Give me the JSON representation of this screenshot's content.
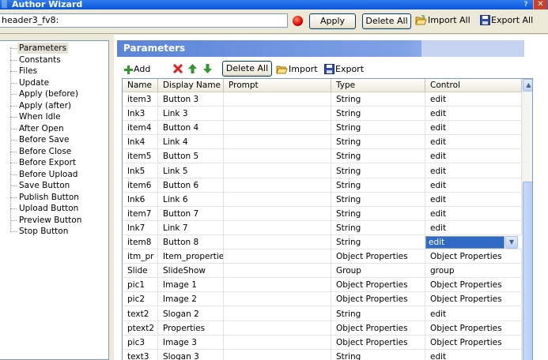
{
  "window": {
    "title": "Author Wizard",
    "help_glyph": "?",
    "close_glyph": "✕"
  },
  "toolbar": {
    "header_value": "header3_fv8:",
    "apply_label": "Apply",
    "delete_all_label": "Delete All",
    "import_all_label": "Import All",
    "export_all_label": "Export All"
  },
  "tree": {
    "items": [
      {
        "label": "Parameters",
        "selected": true
      },
      {
        "label": "Constants"
      },
      {
        "label": "Files"
      },
      {
        "label": "Update"
      },
      {
        "label": "Apply (before)"
      },
      {
        "label": "Apply (after)"
      },
      {
        "label": "When Idle"
      },
      {
        "label": "After Open"
      },
      {
        "label": "Before Save"
      },
      {
        "label": "Before Close"
      },
      {
        "label": "Before Export"
      },
      {
        "label": "Before Upload"
      },
      {
        "label": "Save Button"
      },
      {
        "label": "Publish Button"
      },
      {
        "label": "Upload Button"
      },
      {
        "label": "Preview Button"
      },
      {
        "label": "Stop Button"
      }
    ]
  },
  "panel": {
    "title": "Parameters",
    "add_label": "Add",
    "delete_all_label": "Delete All",
    "import_label": "Import",
    "export_label": "Export"
  },
  "grid": {
    "columns": [
      "Name",
      "Display Name",
      "Prompt",
      "Type",
      "Control"
    ],
    "rows": [
      [
        "item3",
        "Button 3",
        "",
        "String",
        "edit"
      ],
      [
        "lnk3",
        "Link 3",
        "",
        "String",
        "edit"
      ],
      [
        "item4",
        "Button 4",
        "",
        "String",
        "edit"
      ],
      [
        "lnk4",
        "Link 4",
        "",
        "String",
        "edit"
      ],
      [
        "item5",
        "Button 5",
        "",
        "String",
        "edit"
      ],
      [
        "lnk5",
        "Link 5",
        "",
        "String",
        "edit"
      ],
      [
        "item6",
        "Button 6",
        "",
        "String",
        "edit"
      ],
      [
        "lnk6",
        "Link 6",
        "",
        "String",
        "edit"
      ],
      [
        "item7",
        "Button 7",
        "",
        "String",
        "edit"
      ],
      [
        "lnk7",
        "Link 7",
        "",
        "String",
        "edit"
      ],
      [
        "item8",
        "Button 8",
        "",
        "String",
        "edit"
      ],
      [
        "itm_pr",
        "Item_properties",
        "",
        "Object Properties",
        "Object Properties"
      ],
      [
        "Slide",
        "SlideShow",
        "",
        "Group",
        "group"
      ],
      [
        "pic1",
        "Image 1",
        "",
        "Object Properties",
        "Object Properties"
      ],
      [
        "pic2",
        "Image 2",
        "",
        "Object Properties",
        "Object Properties"
      ],
      [
        "text2",
        "Slogan 2",
        "",
        "String",
        "edit"
      ],
      [
        "ptext2",
        "Properties",
        "",
        "Object Properties",
        "Object Properties"
      ],
      [
        "pic3",
        "Image 3",
        "",
        "Object Properties",
        "Object Properties"
      ],
      [
        "text3",
        "Slogan 3",
        "",
        "String",
        "edit"
      ]
    ],
    "active_row": 10,
    "active_col": 4
  },
  "colors": {
    "title_blue": "#0a55d8",
    "selection": "#316ac5",
    "record": "#d90000",
    "panel_header": "#5b84d8"
  }
}
